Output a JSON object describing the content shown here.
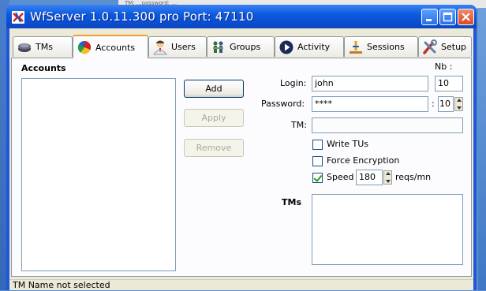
{
  "background_window": {
    "text": "TM: ...password: ..."
  },
  "window": {
    "title": "WfServer 1.0.11.300 pro   Port: 47110",
    "titlebar_color": "#0a4fd4"
  },
  "tabs": [
    {
      "label": "TMs",
      "icon": "database-icon"
    },
    {
      "label": "Accounts",
      "icon": "pie-chart-icon"
    },
    {
      "label": "Users",
      "icon": "user-icon"
    },
    {
      "label": "Groups",
      "icon": "group-icon"
    },
    {
      "label": "Activity",
      "icon": "play-icon"
    },
    {
      "label": "Sessions",
      "icon": "warning-icon"
    },
    {
      "label": "Setup",
      "icon": "tools-icon"
    }
  ],
  "active_tab": "Accounts",
  "accounts": {
    "list_title": "Accounts",
    "add_label": "Add",
    "apply_label": "Apply",
    "remove_label": "Remove"
  },
  "form": {
    "login_label": "Login:",
    "login_value": "john",
    "nb_label": "Nb :",
    "nb_value": "10",
    "password_label": "Password:",
    "password_value": "****",
    "password_colon": ":",
    "password_spin_value": "10",
    "tm_label": "TM:",
    "tm_value": "",
    "write_tus_label": "Write TUs",
    "write_tus_checked": false,
    "force_encryption_label": "Force Encryption",
    "force_encryption_checked": false,
    "speed_label": "Speed",
    "speed_checked": true,
    "speed_value": "180",
    "speed_unit": "reqs/mn",
    "tms_label": "TMs"
  },
  "status": {
    "text": "TM Name not selected"
  }
}
